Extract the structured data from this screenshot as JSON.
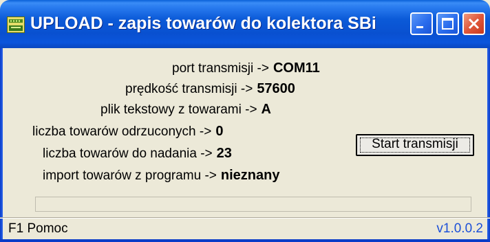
{
  "window": {
    "title": "UPLOAD - zapis towarów do kolektora SBi"
  },
  "fields": [
    {
      "label": "port transmisji ->",
      "value": "COM11"
    },
    {
      "label": "prędkość transmisji ->",
      "value": "57600"
    },
    {
      "label": "plik tekstowy z towarami ->",
      "value": "A"
    },
    {
      "label": "liczba towarów odrzuconych ->",
      "value": "0"
    },
    {
      "label": "liczba towarów do nadania ->",
      "value": "23"
    },
    {
      "label": "import towarów z programu ->",
      "value": "nieznany"
    }
  ],
  "buttons": {
    "start_label": "Start transmisji"
  },
  "progress": {
    "value": 0
  },
  "statusbar": {
    "help": "F1 Pomoc",
    "version": "v1.0.0.2",
    "version_color": "#1b4fd8"
  },
  "icons": {
    "app": "app-icon",
    "minimize": "minimize-icon",
    "maximize": "maximize-icon",
    "close": "close-icon"
  }
}
